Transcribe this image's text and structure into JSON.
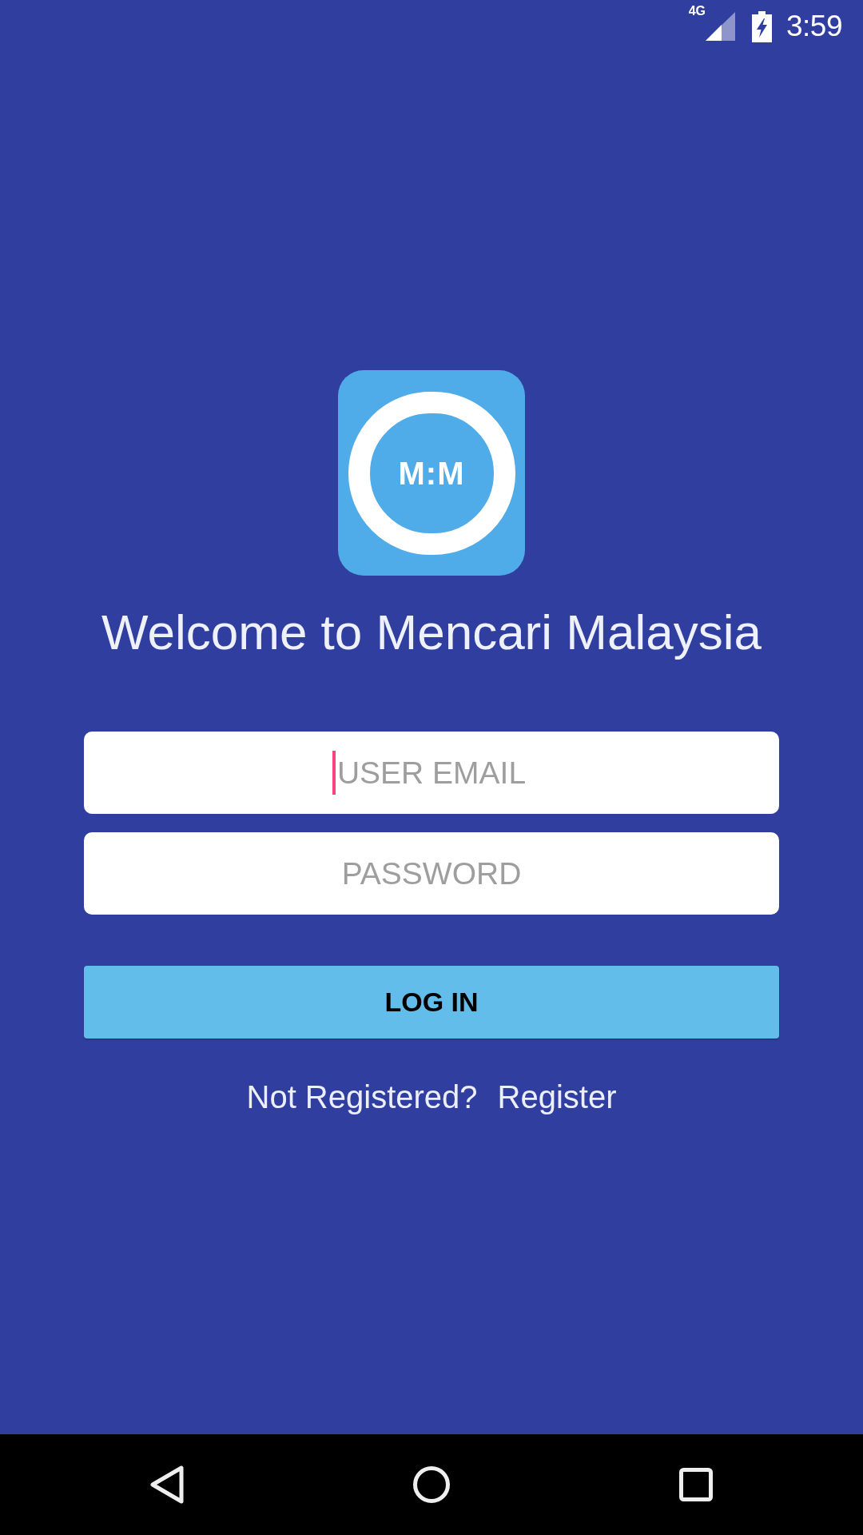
{
  "status_bar": {
    "network": "4G",
    "time": "3:59"
  },
  "logo": {
    "text": "M:M"
  },
  "title": "Welcome to Mencari Malaysia",
  "form": {
    "fields": [
      {
        "placeholder": "USER EMAIL",
        "focused": true
      },
      {
        "placeholder": "PASSWORD",
        "focused": false
      }
    ],
    "submit": "LOG IN"
  },
  "register_prompt": {
    "text": "Not Registered?",
    "link": "Register"
  }
}
